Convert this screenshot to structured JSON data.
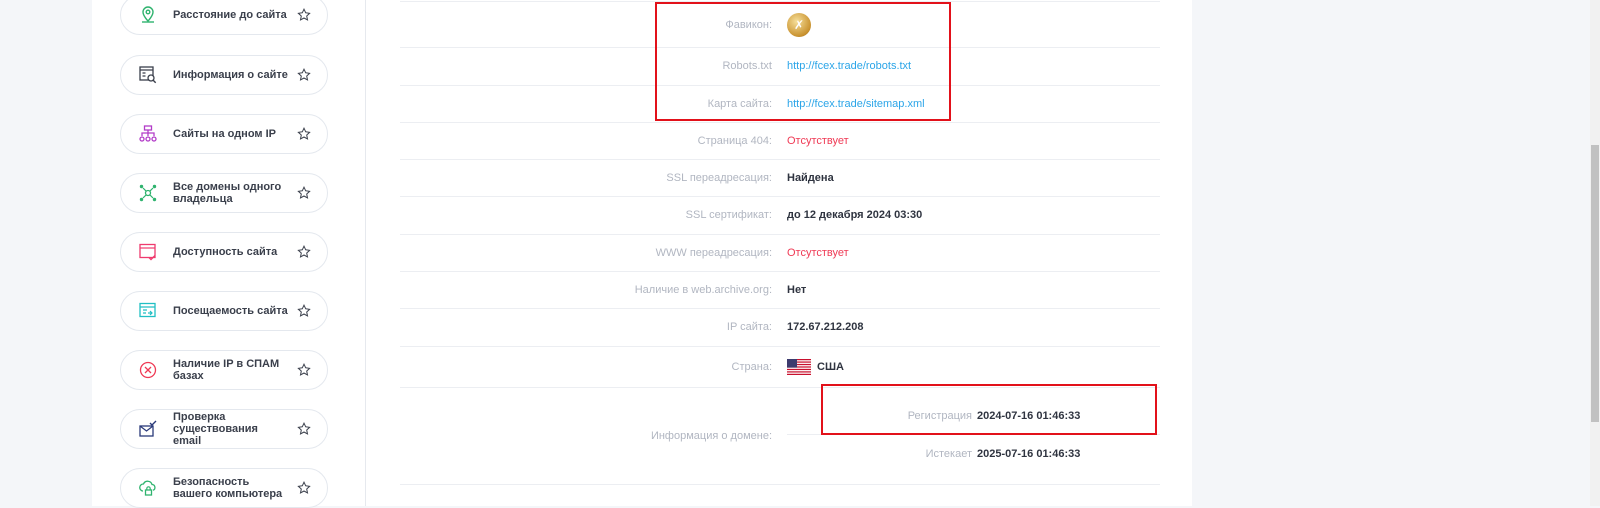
{
  "sidebar": {
    "items": [
      {
        "label": "Расстояние до сайта",
        "icon": "location-pin-icon",
        "color": "#2fb36e"
      },
      {
        "label": "Информация о сайте",
        "icon": "site-info-icon",
        "color": "#3a3f4b"
      },
      {
        "label": "Сайты на одном IP",
        "icon": "network-tree-icon",
        "color": "#b23cc8"
      },
      {
        "label": "Все домены одного владельца",
        "icon": "nodes-icon",
        "color": "#2fb36e"
      },
      {
        "label": "Доступность сайта",
        "icon": "browser-check-icon",
        "color": "#ef3a6e"
      },
      {
        "label": "Посещаемость сайта",
        "icon": "browser-traffic-icon",
        "color": "#21bfc4"
      },
      {
        "label": "Наличие IP в СПАМ базах",
        "icon": "circle-x-icon",
        "color": "#ef3a55"
      },
      {
        "label": "Проверка существования email",
        "icon": "mail-check-icon",
        "color": "#2a3a7a"
      },
      {
        "label": "Безопасность вашего компьютера",
        "icon": "cloud-lock-icon",
        "color": "#2fb36e"
      }
    ]
  },
  "info": {
    "favicon_label": "Фавикон:",
    "robots_label": "Robots.txt",
    "robots_value": "http://fcex.trade/robots.txt",
    "sitemap_label": "Карта сайта:",
    "sitemap_value": "http://fcex.trade/sitemap.xml",
    "page404_label": "Страница 404:",
    "page404_value": "Отсутствует",
    "ssl_redirect_label": "SSL переадресация:",
    "ssl_redirect_value": "Найдена",
    "ssl_cert_label": "SSL сертификат:",
    "ssl_cert_value": "до 12 декабря 2024 03:30",
    "www_redirect_label": "WWW переадресация:",
    "www_redirect_value": "Отсутствует",
    "archive_label": "Наличие в web.archive.org:",
    "archive_value": "Нет",
    "ip_label": "IP сайта:",
    "ip_value": "172.67.212.208",
    "country_label": "Страна:",
    "country_value": "США",
    "domain_label": "Информация о домене:",
    "registration_label": "Регистрация",
    "registration_value": "2024-07-16 01:46:33",
    "expires_label": "Истекает",
    "expires_value": "2025-07-16 01:46:33"
  },
  "colors": {
    "link": "#2ba5e8",
    "negative": "#ef3a55",
    "highlight_box": "#e2111a"
  }
}
